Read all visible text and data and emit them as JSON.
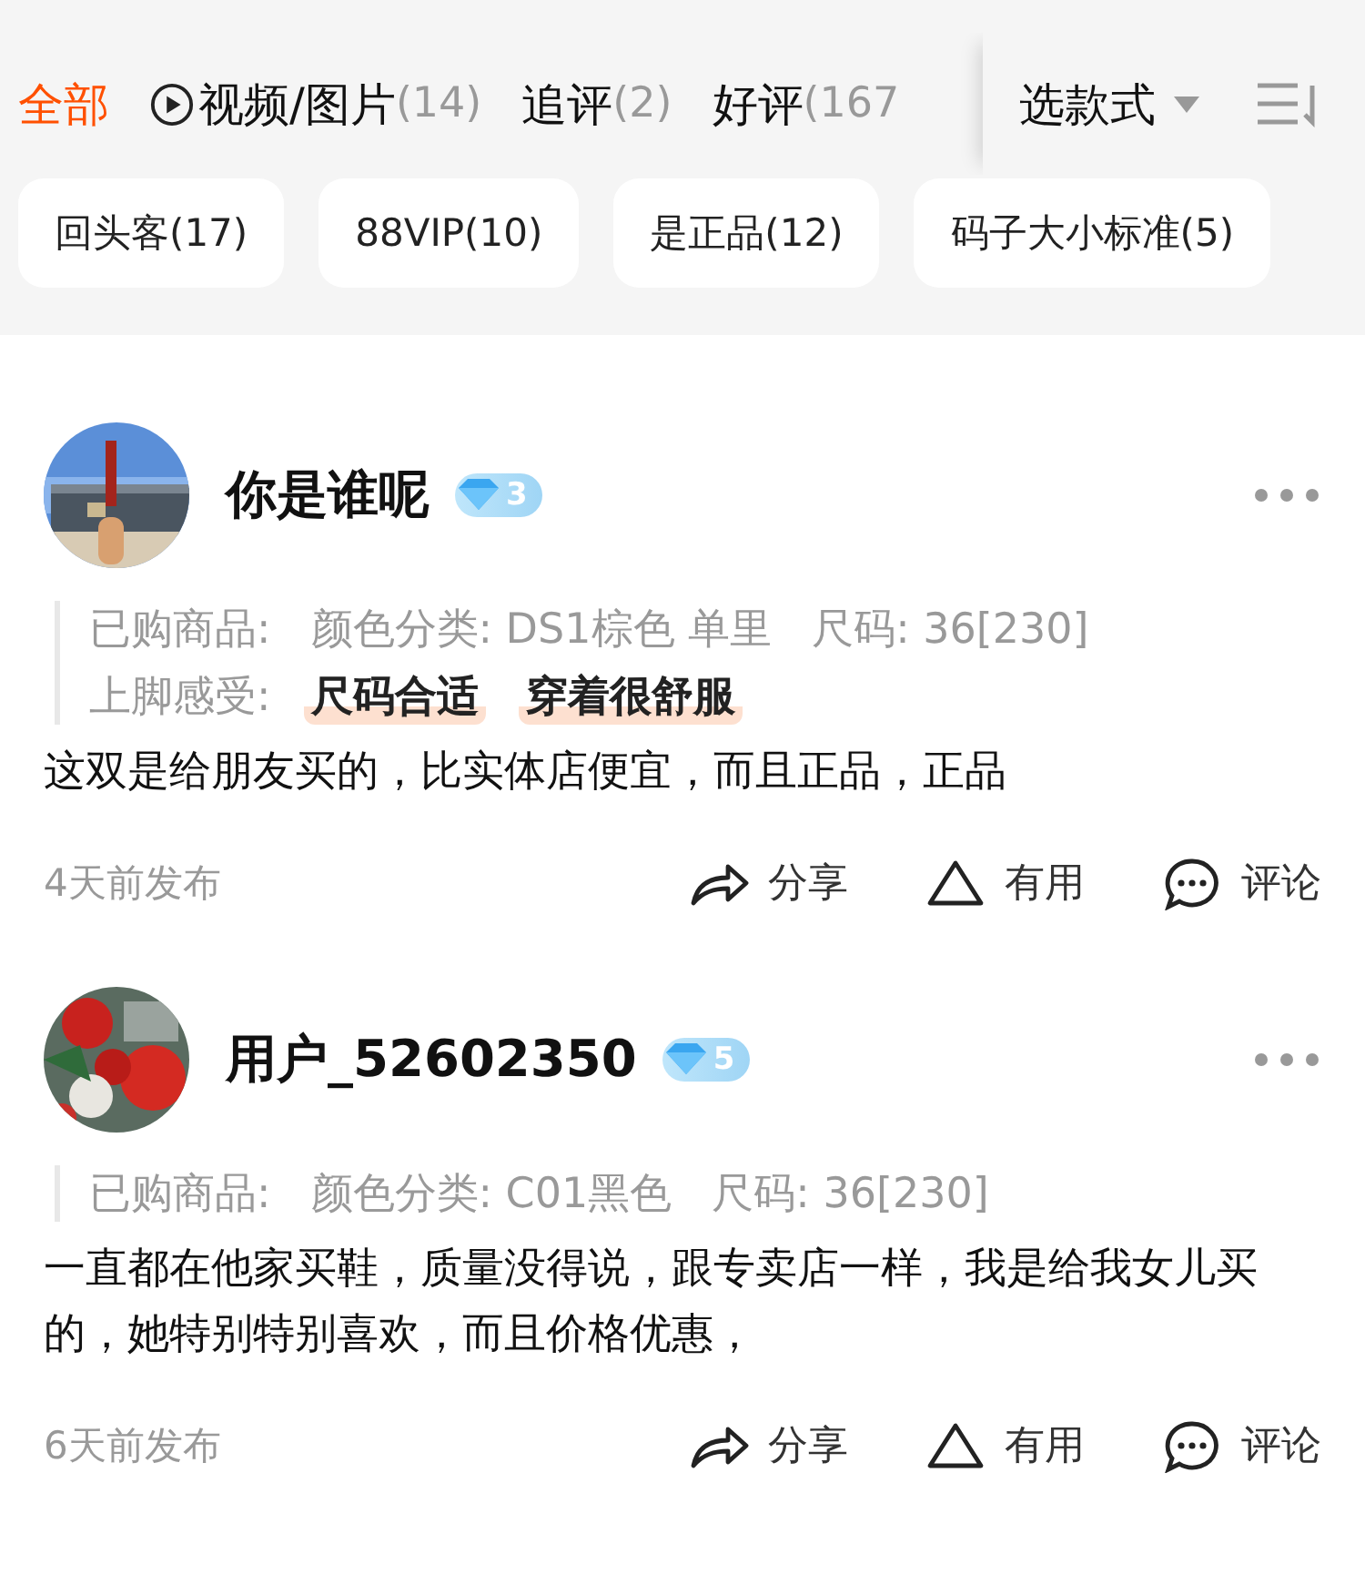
{
  "tabs": [
    {
      "label": "全部",
      "selected": true
    },
    {
      "label": "视频/图片",
      "count": "(14)",
      "kind": "video",
      "selected": false
    },
    {
      "label": "追评",
      "count": "(2)",
      "selected": false
    },
    {
      "label": "好评",
      "count": "(167",
      "selected": false
    }
  ],
  "style_picker": {
    "label": "选款式"
  },
  "chips": [
    "回头客(17)",
    "88VIP(10)",
    "是正品(12)",
    "码子大小标准(5)"
  ],
  "reviews": [
    {
      "avatar": {
        "kind": "picture"
      },
      "name": "你是谁呢",
      "level": "3",
      "purchase": [
        "已购商品:",
        "颜色分类: DS1棕色 单里",
        "尺码: 36[230]"
      ],
      "feel_label": "上脚感受:",
      "feel_tags": [
        "尺码合适",
        "穿着很舒服"
      ],
      "text": "这双是给朋友买的，比实体店便宜，而且正品，正品",
      "time": "4天前发布",
      "actions": [
        "分享",
        "有用",
        "评论"
      ]
    },
    {
      "avatar": {
        "kind": "picture"
      },
      "name": "用户_52602350",
      "level": "5",
      "purchase": [
        "已购商品:",
        "颜色分类: C01黑色",
        "尺码: 36[230]"
      ],
      "text": "一直都在他家买鞋，质量没得说，跟专卖店一样，我是给我女儿买的，她特别特别喜欢，而且价格优惠，",
      "time": "6天前发布",
      "actions": [
        "分享",
        "有用",
        "评论"
      ]
    }
  ]
}
